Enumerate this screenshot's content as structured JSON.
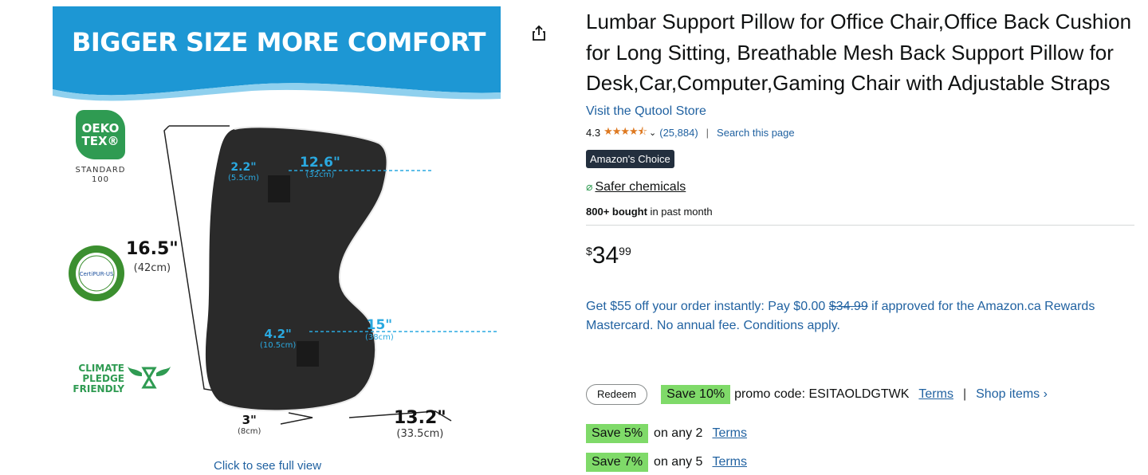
{
  "image": {
    "banner_text": "BIGGER SIZE MORE COMFORT",
    "certifications": {
      "oeko_line1": "OEKO",
      "oeko_line2": "TEX®",
      "oeko_standard_line1": "STANDARD",
      "oeko_standard_line2": "100",
      "certipur": "CertiPUR-US",
      "climate_line1": "CLIMATE",
      "climate_line2": "PLEDGE",
      "climate_line3": "FRIENDLY"
    },
    "dimensions": {
      "height_in": "16.5\"",
      "height_cm": "(42cm)",
      "top_width_in": "12.6\"",
      "top_width_cm": "(32cm)",
      "top_depth_in": "2.2\"",
      "top_depth_cm": "(5.5cm)",
      "mid_width_in": "15\"",
      "mid_width_cm": "(38cm)",
      "mid_depth_in": "4.2\"",
      "mid_depth_cm": "(10.5cm)",
      "base_depth_in": "3\"",
      "base_depth_cm": "(8cm)",
      "base_width_in": "13.2\"",
      "base_width_cm": "(33.5cm)"
    },
    "full_view_link": "Click to see full view"
  },
  "share_icon": "share-icon",
  "product": {
    "title": "Lumbar Support Pillow for Office Chair,Office Back Cushion for Long Sitting, Breathable Mesh Back Support Pillow for Desk,Car,Computer,Gaming Chair with Adjustable Straps",
    "store_link": "Visit the Qutool Store",
    "rating_value": "4.3",
    "stars": "★★★★⯪",
    "rating_count": "(25,884)",
    "rating_separator": "|",
    "search_page": "Search this page",
    "choice_badge": "Amazon's Choice",
    "safer_label": "Safer chemicals",
    "bought_bold": "800+ bought",
    "bought_rest": " in past month",
    "price_symbol": "$",
    "price_whole": "34",
    "price_fraction": "99",
    "offer_part1": "Get $55 off your order instantly: Pay $0.00 ",
    "offer_strike": "$34.99",
    "offer_part2": " if approved for the Amazon.ca Rewards Mastercard. No annual fee. Conditions apply.",
    "promo": {
      "redeem_label": "Redeem",
      "save_badge": "Save 10%",
      "promo_text": "promo code: ESITAOLDGTWK",
      "terms": "Terms",
      "separator": "|",
      "shop_items": "Shop items ›"
    },
    "discounts": [
      {
        "badge": "Save 5%",
        "text": "on any 2",
        "terms": "Terms"
      },
      {
        "badge": "Save 7%",
        "text": "on any 5",
        "terms": "Terms"
      }
    ]
  },
  "colors": {
    "banner_blue": "#1d97d4",
    "link_blue": "#2162a1",
    "save_green": "#7fda69",
    "star_orange": "#de7921",
    "badge_dark": "#232f3e"
  }
}
